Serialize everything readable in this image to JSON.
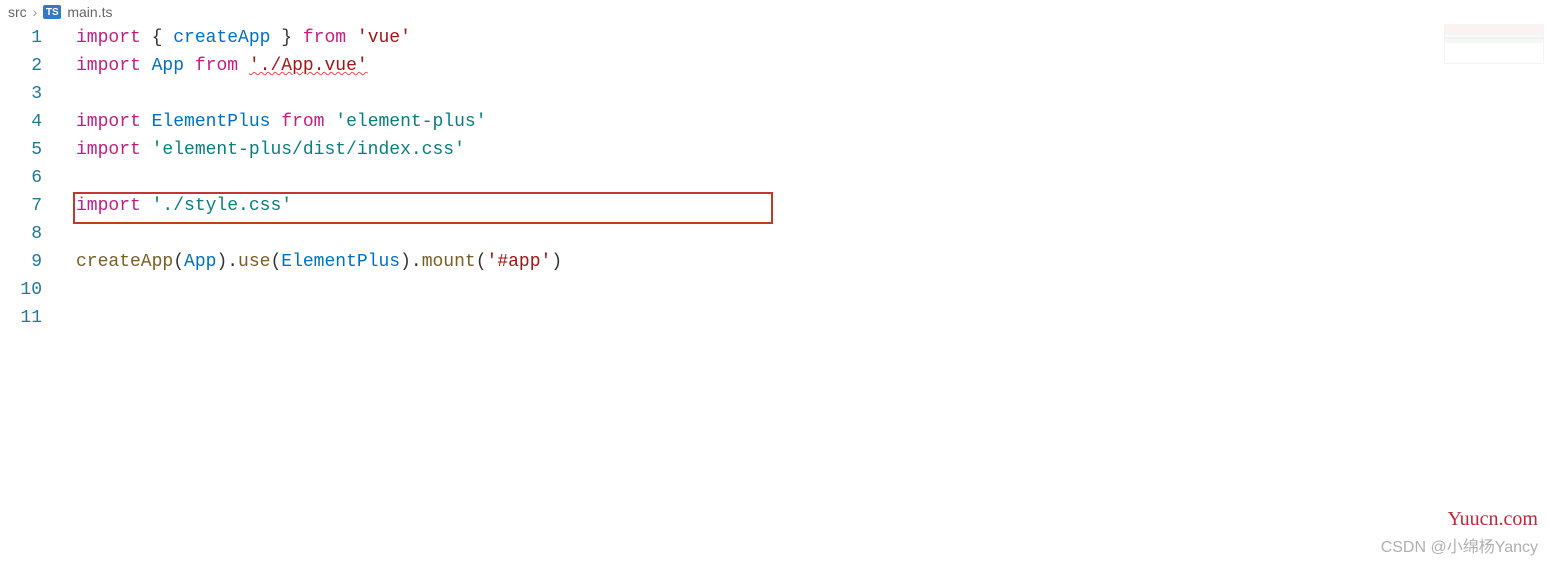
{
  "breadcrumb": {
    "folder": "src",
    "file": "main.ts",
    "badge": "TS"
  },
  "lines": {
    "count": 11,
    "l1": {
      "kw1": "import",
      "br1": "{ ",
      "id": "createApp",
      "br2": " }",
      "kw2": "from",
      "str": "'vue'"
    },
    "l2": {
      "kw1": "import",
      "id": "App",
      "kw2": "from",
      "str": "'./App.vue'"
    },
    "l4": {
      "kw1": "import",
      "id": "ElementPlus",
      "kw2": "from",
      "str": "'element-plus'"
    },
    "l5": {
      "kw1": "import",
      "str": "'element-plus/dist/index.css'"
    },
    "l7": {
      "kw1": "import",
      "str": "'./style.css'"
    },
    "l9": {
      "fn1": "createApp",
      "p1": "(",
      "id1": "App",
      "p2": ").",
      "fn2": "use",
      "p3": "(",
      "id2": "ElementPlus",
      "p4": ").",
      "fn3": "mount",
      "p5": "(",
      "str": "'#app'",
      "p6": ")"
    }
  },
  "watermark": "Yuucn.com",
  "watermark2": "CSDN @小绵杨Yancy"
}
